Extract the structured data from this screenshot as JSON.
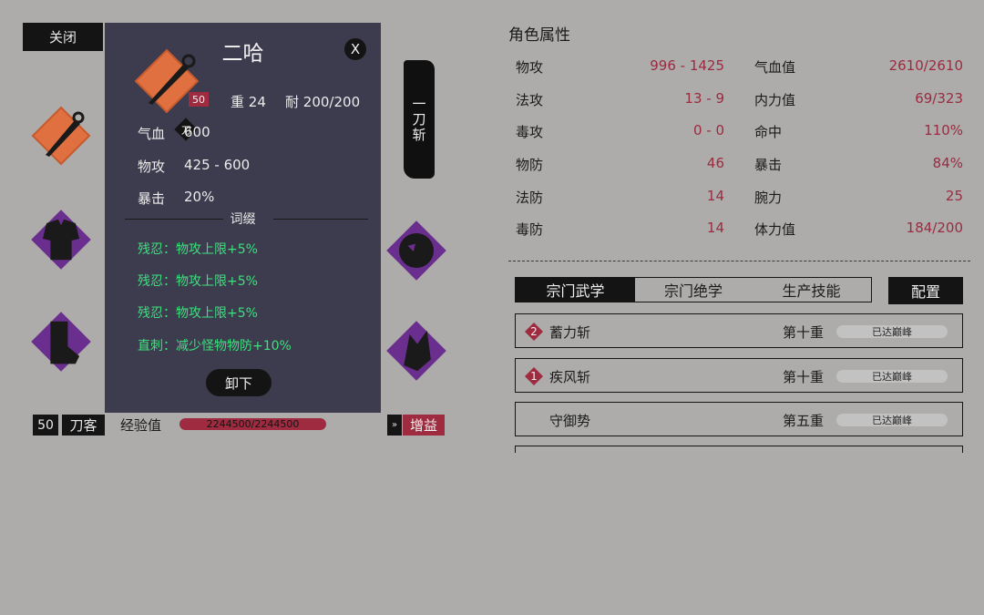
{
  "left": {
    "close_label": "关闭",
    "level": "50",
    "class_name": "刀客",
    "exp_label": "经验值",
    "exp_value": "2244500/2244500",
    "exp_progress": 1.0,
    "buff_arrow": "»",
    "buff_label": "增益",
    "skill_banner": [
      "一",
      "刀",
      "斩"
    ],
    "colors": {
      "orange_slot": "#e0703f",
      "purple_slot": "#6a2e8e",
      "accent_red": "#9e2b3f"
    }
  },
  "tooltip": {
    "title": "二哈",
    "close_label": "X",
    "icon_level": "50",
    "icon_type": "刀",
    "weight_label": "重",
    "weight_value": "24",
    "durability_label": "耐",
    "durability_value": "200/200",
    "stats": [
      {
        "label": "气血",
        "value": "600"
      },
      {
        "label": "物攻",
        "value": "425 - 600"
      },
      {
        "label": "暴击",
        "value": "20%"
      }
    ],
    "affix_title": "词缀",
    "affixes": [
      "残忍：物攻上限+5%",
      "残忍：物攻上限+5%",
      "残忍：物攻上限+5%",
      "直刺：减少怪物物防+10%"
    ],
    "unequip_label": "卸下"
  },
  "attributes": {
    "title": "角色属性",
    "left_col": [
      {
        "name": "物攻",
        "value": "996 - 1425"
      },
      {
        "name": "法攻",
        "value": "13 - 9"
      },
      {
        "name": "毒攻",
        "value": "0 - 0"
      },
      {
        "name": "物防",
        "value": "46"
      },
      {
        "name": "法防",
        "value": "14"
      },
      {
        "name": "毒防",
        "value": "14"
      }
    ],
    "right_col": [
      {
        "name": "气血值",
        "value": "2610/2610"
      },
      {
        "name": "内力值",
        "value": "69/323"
      },
      {
        "name": "命中",
        "value": "110%"
      },
      {
        "name": "暴击",
        "value": "84%"
      },
      {
        "name": "腕力",
        "value": "25"
      },
      {
        "name": "体力值",
        "value": "184/200"
      }
    ]
  },
  "skills": {
    "tabs": [
      "宗门武学",
      "宗门绝学",
      "生产技能"
    ],
    "active_tab": 0,
    "config_label": "配置",
    "rows": [
      {
        "badge": "2",
        "name": "蓄力斩",
        "tier": "第十重",
        "status": "已达巅峰"
      },
      {
        "badge": "1",
        "name": "疾风斩",
        "tier": "第十重",
        "status": "已达巅峰"
      },
      {
        "badge": "",
        "name": "守御势",
        "tier": "第五重",
        "status": "已达巅峰"
      }
    ]
  }
}
